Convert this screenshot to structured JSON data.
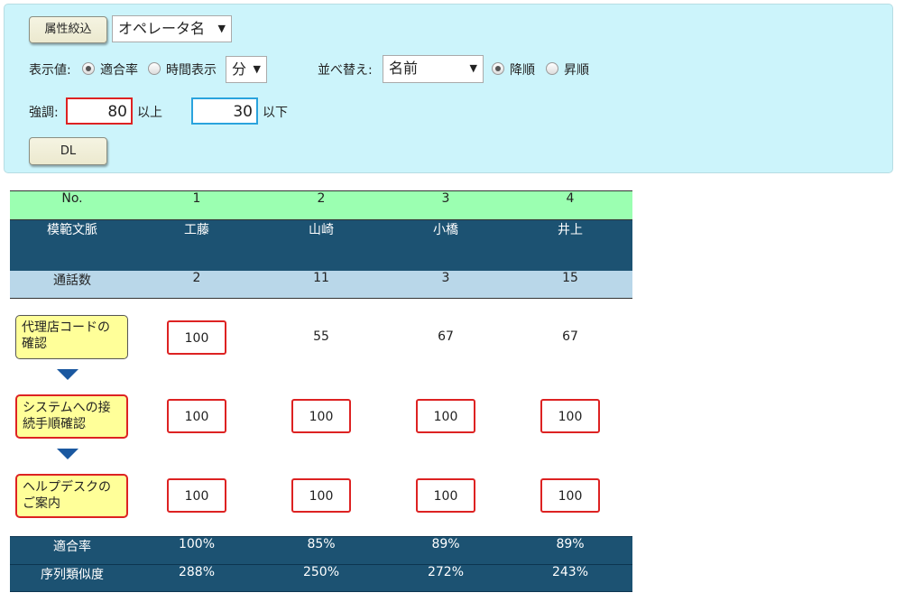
{
  "filter_panel": {
    "filter_button": "属性絞込",
    "attribute_select": "オペレータ名",
    "display_label": "表示値:",
    "display_options": [
      {
        "label": "適合率",
        "selected": true
      },
      {
        "label": "時間表示",
        "selected": false
      }
    ],
    "time_unit_select": "分",
    "sort_label": "並べ替え:",
    "sort_select": "名前",
    "sort_order": [
      {
        "label": "降順",
        "selected": true
      },
      {
        "label": "昇順",
        "selected": false
      }
    ],
    "highlight_label": "強調:",
    "upper_value": "80",
    "upper_suffix": "以上",
    "lower_value": "30",
    "lower_suffix": "以下",
    "download_button": "DL"
  },
  "table": {
    "no_header": "No.",
    "numbers": [
      "1",
      "2",
      "3",
      "4"
    ],
    "context_header": "模範文脈",
    "operators": [
      "工藤",
      "山崎",
      "小橋",
      "井上"
    ],
    "calls_header": "通話数",
    "calls": [
      "2",
      "11",
      "3",
      "15"
    ],
    "steps": [
      {
        "label": "代理店コードの確認",
        "highlighted": false,
        "scores": [
          {
            "value": "100",
            "highlighted": true
          },
          {
            "value": "55",
            "highlighted": false
          },
          {
            "value": "67",
            "highlighted": false
          },
          {
            "value": "67",
            "highlighted": false
          }
        ]
      },
      {
        "label": "システムへの接続手順確認",
        "highlighted": true,
        "scores": [
          {
            "value": "100",
            "highlighted": true
          },
          {
            "value": "100",
            "highlighted": true
          },
          {
            "value": "100",
            "highlighted": true
          },
          {
            "value": "100",
            "highlighted": true
          }
        ]
      },
      {
        "label": "ヘルプデスクのご案内",
        "highlighted": true,
        "scores": [
          {
            "value": "100",
            "highlighted": true
          },
          {
            "value": "100",
            "highlighted": true
          },
          {
            "value": "100",
            "highlighted": true
          },
          {
            "value": "100",
            "highlighted": true
          }
        ]
      }
    ],
    "fit_header": "適合率",
    "fit_rates": [
      "100%",
      "85%",
      "89%",
      "89%"
    ],
    "similarity_header": "序列類似度",
    "similarities": [
      "288%",
      "250%",
      "272%",
      "243%"
    ]
  },
  "colors": {
    "panel_bg": "#ccf4fb",
    "header_green": "#9bffb1",
    "header_navy": "#1c5272",
    "calls_row": "#b9d7e9",
    "step_yellow": "#ffff99",
    "highlight_red": "#dd2222",
    "lower_blue": "#2aa3dd",
    "arrow_blue": "#1a58a0"
  }
}
